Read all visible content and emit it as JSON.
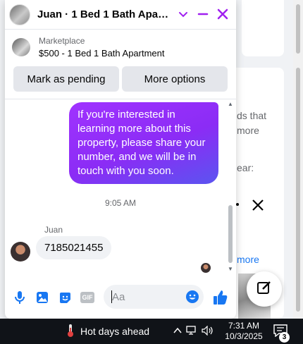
{
  "chat": {
    "title": "Juan · 1 Bed 1 Bath Apartm...",
    "listing_source": "Marketplace",
    "listing_title": "$500 - 1 Bed 1 Bath Apartment",
    "actions": [
      "Mark as pending",
      "More options"
    ],
    "outgoing_message": "If you're interested in learning more about this property, please share your number, and we will be in touch with you soon.",
    "timestamp": "9:05 AM",
    "sender_name": "Juan",
    "incoming_message": "7185021455",
    "input_placeholder": "Aa",
    "accent_color": "#a020f0",
    "like_color": "#1877f2"
  },
  "background": {
    "snippets": [
      "ds that",
      "more",
      "ear:",
      "more"
    ]
  },
  "taskbar": {
    "weather_text": "Hot days ahead",
    "time": "7:31 AM",
    "date": "10/3/2025",
    "notification_count": "3"
  },
  "icons": [
    "chevron-down-icon",
    "minimize-icon",
    "close-icon",
    "microphone-icon",
    "photo-icon",
    "sticker-icon",
    "gif-icon",
    "emoji-icon",
    "thumbs-up-icon",
    "compose-icon",
    "thermometer-icon",
    "chevron-up-icon",
    "network-icon",
    "speaker-icon",
    "notification-icon"
  ]
}
